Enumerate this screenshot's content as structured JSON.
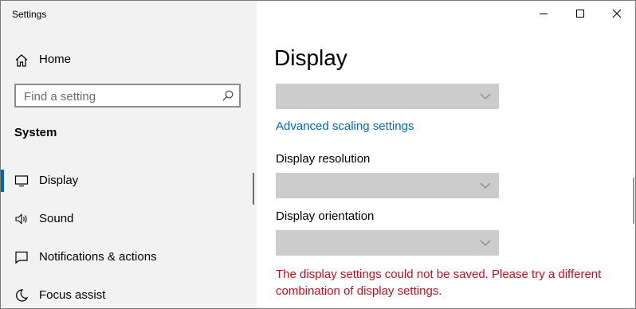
{
  "window": {
    "title": "Settings"
  },
  "titlebar": {
    "controls": [
      "minimize-icon",
      "maximize-icon",
      "close-icon"
    ]
  },
  "sidebar": {
    "home_label": "Home",
    "search": {
      "placeholder": "Find a setting",
      "value": ""
    },
    "section_heading": "System",
    "items": [
      {
        "label": "Display",
        "icon": "monitor-icon",
        "selected": true
      },
      {
        "label": "Sound",
        "icon": "speaker-icon",
        "selected": false
      },
      {
        "label": "Notifications & actions",
        "icon": "notification-icon",
        "selected": false
      },
      {
        "label": "Focus assist",
        "icon": "moon-icon",
        "selected": false
      }
    ]
  },
  "main": {
    "title": "Display",
    "advanced_scaling_link": "Advanced scaling settings",
    "resolution_label": "Display resolution",
    "orientation_label": "Display orientation",
    "error_message": "The display settings could not be saved. Please try a different combination of display settings."
  },
  "colors": {
    "accent": "#0063b1",
    "link": "#0067b8",
    "error": "#c50f1f",
    "sidebar_bg": "#f2f2f2",
    "dropdown_bg": "#cccccc"
  }
}
